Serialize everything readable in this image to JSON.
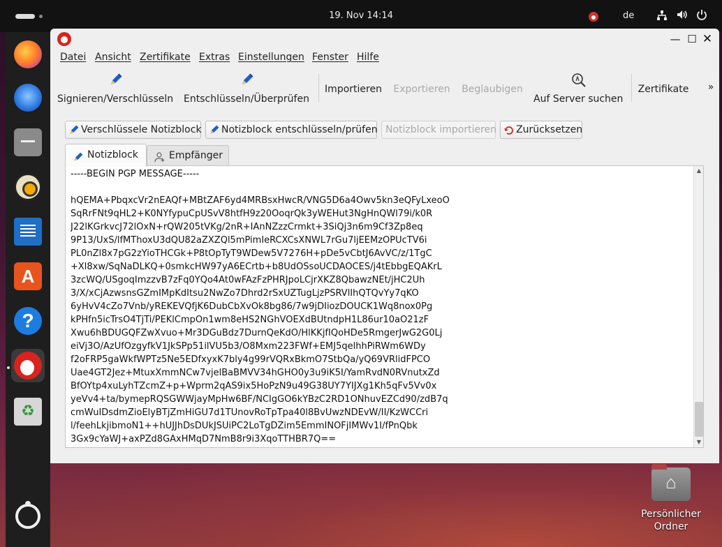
{
  "top_panel": {
    "clock": "19. Nov  14:14",
    "language": "de",
    "icons": [
      "network-icon",
      "volume-icon",
      "power-icon",
      "kleopatra-tray-icon"
    ]
  },
  "dock": {
    "items": [
      "firefox",
      "thunderbird",
      "files",
      "rhythmbox",
      "libreoffice-writer",
      "app-center",
      "help",
      "kleopatra",
      "trash",
      "show-apps"
    ]
  },
  "desktop": {
    "home_folder_label": "Persönlicher Ordner"
  },
  "menu": {
    "datei": "Datei",
    "ansicht": "Ansicht",
    "zertifikate": "Zertifikate",
    "extras": "Extras",
    "einstellungen": "Einstellungen",
    "fenster": "Fenster",
    "hilfe": "Hilfe"
  },
  "toolbar": {
    "sign_encrypt": "Signieren/Verschlüsseln",
    "decrypt_verify": "Entschlüsseln/Überprüfen",
    "import": "Importieren",
    "export": "Exportieren",
    "certify": "Beglaubigen",
    "lookup": "Auf Server suchen",
    "certificates": "Zertifikate",
    "overflow": "»"
  },
  "notepad_actions": {
    "encrypt": "Verschlüssele Notizblock",
    "decrypt": "Notizblock entschlüsseln/prüfen",
    "import": "Notizblock importieren",
    "reset": "Zurücksetzen"
  },
  "tabs": {
    "notepad": "Notizblock",
    "recipients": "Empfänger"
  },
  "editor": {
    "content": "-----BEGIN PGP MESSAGE-----\n\nhQEMA+PbqxcVr2nEAQf+MBtZAF6yd4MRBsxHwcR/VNG5D6a4Owv5kn3eQFyLxeoO\nSqRrFNt9qHL2+K0NYfypuCpUSvV8htfH9z20OoqrQk3yWEHut3NgHnQWl79i/k0R\nJ22lKGrkvcJ72lOxN+rQW205tVKg/2nR+IAnNZzzCrmkt+3SiQj3n6m9Cf3Zp8eq\n9P13/UxS/lfMThoxU3dQU82aZXZQl5mPimIeRCXCsXNWL7rGu7ljEEMzOPUcTV6i\nPL0nZl8x7pG2zYioTHCGk+P8tOpTyT9WDew5V7276H+pDe5vCbtJ6AvVC/z/1TgC\n+Xl8xw/SqNaDLKQ+0smkcHW97yA6ECrtb+b8UdOSsoUCDAOCES/j4tEbbgEQAKrL\n3zcWQ/USgoqImzzvB7zFq0YQo4At0wFAzFzPHRJpoLCjrXKZ8QbawzNEt/jHC2Uh\n3/X/xCjAzwsnsGZmIMpKdItsu2NwZo7Dhrd2rSxUZTugLjzPSRVlIhQTQvYy7qKO\n6yHvV4cZo7Vnb/yREKEVQfjK6DubCbXvOk8bg86/7w9jDIiozDOUCK1Wq8nox0Pg\nkPHfn5icTrsO4TjTi/PEKlCmpOn1wm8eHS2NGhVOEXdBUtndpH1L86ur10aO21zF\nXwu6hBDUGQFZwXvuo+Mr3DGuBdz7DurnQeKdO/HlKKjfIQoHDe5RmgerJwG2G0Lj\neiVj3O/AzUfOzgyfkV1JkSPp51ilVU5b3/O8Mxm223FWf+EMJ5qelhhPiRWm6WDy\nf2oFRP5gaWkfWPTz5Ne5EDfxyxK7bly4g99rVQRxBkmO7StbQa/yQ69VRlidFPCO\nUae4GT2Jez+MtuxXmmNCw7vjelBaBMVV34hGHO0y3u9iK5I/YamRvdN0RVnutxZd\nBfOYtp4xuLyhTZcmZ+p+Wprm2qAS9ix5HoPzN9u49G38UY7YIJXg1Kh5qFv5Vv0x\nyeVv4+ta/bymepRQSGWWjayMpHw6BF/NCIgGO6kYBzC2RD1ONhuvEZCd90/zdB7q\ncmWuIDsdmZioElyBTjZmHiGU7d1TUnovRoTpTpa40l8BvUwzNDEvW/II/KzWCCri\nl/feehLkjibmoN1++hUJJhDsDUkJSUiPC2LoTgDZim5EmmINOFjIMWv1I/fPnQbk\n3Gx9cYaWJ+axPZd8GAxHMqD7NmB8r9i3XqoTTHBR7Q=="
  },
  "colors": {
    "accent_red": "#d8231e",
    "pen_blue": "#1d5fc8",
    "window_bg": "#efefef"
  }
}
